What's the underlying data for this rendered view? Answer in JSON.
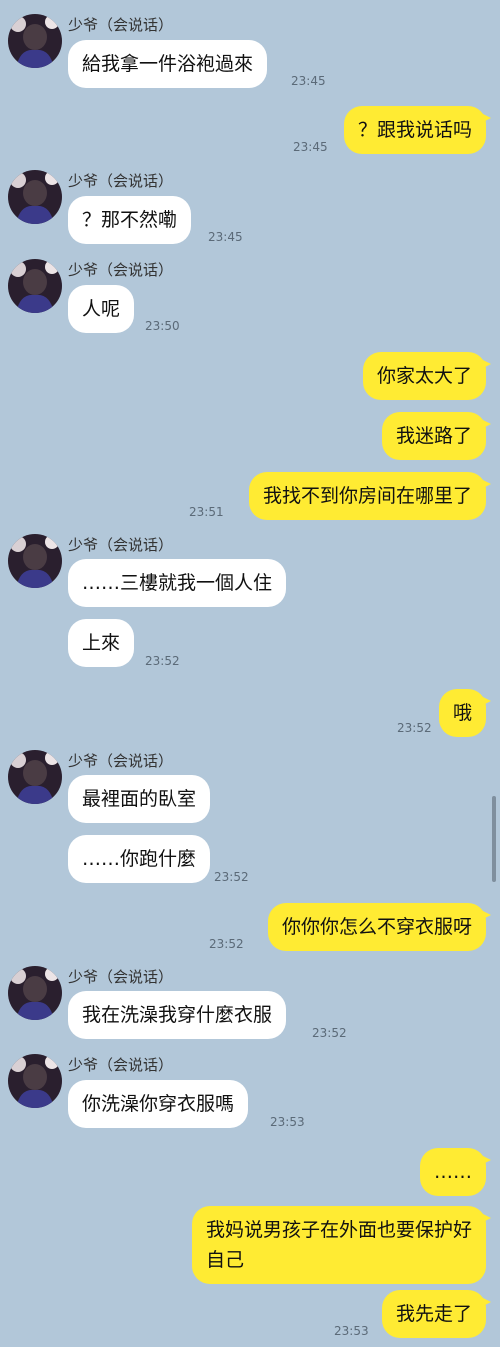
{
  "contact": {
    "name": "少爷（会说话）"
  },
  "colors": {
    "background": "#b2c7d9",
    "incoming": "#ffffff",
    "outgoing": "#ffeb33"
  },
  "messages": [
    {
      "dir": "in",
      "text": "給我拿一件浴袍過來",
      "time": "23:45"
    },
    {
      "dir": "out",
      "text": "？跟我说话吗",
      "time": "23:45"
    },
    {
      "dir": "in",
      "text": "？那不然嘞",
      "time": "23:45"
    },
    {
      "dir": "in",
      "text": "人呢",
      "time": "23:50"
    },
    {
      "dir": "out",
      "text": "你家太大了",
      "time": ""
    },
    {
      "dir": "out",
      "text": "我迷路了",
      "time": ""
    },
    {
      "dir": "out",
      "text": "我找不到你房间在哪里了",
      "time": "23:51"
    },
    {
      "dir": "in",
      "text": "……三樓就我一個人住",
      "time": ""
    },
    {
      "dir": "in",
      "text": "上來",
      "time": "23:52"
    },
    {
      "dir": "out",
      "text": "哦",
      "time": "23:52"
    },
    {
      "dir": "in",
      "text": "最裡面的臥室",
      "time": ""
    },
    {
      "dir": "in",
      "text": "……你跑什麼",
      "time": "23:52"
    },
    {
      "dir": "out",
      "text": "你你你怎么不穿衣服呀",
      "time": "23:52"
    },
    {
      "dir": "in",
      "text": "我在洗澡我穿什麼衣服",
      "time": "23:52"
    },
    {
      "dir": "in",
      "text": "你洗澡你穿衣服嗎",
      "time": "23:53"
    },
    {
      "dir": "out",
      "text": "……",
      "time": ""
    },
    {
      "dir": "out",
      "text": "我妈说男孩子在外面也要保护好自己",
      "line1": "我妈说男孩子在外面也要保护好",
      "line2": "自己",
      "time": ""
    },
    {
      "dir": "out",
      "text": "我先走了",
      "time": "23:53"
    }
  ]
}
